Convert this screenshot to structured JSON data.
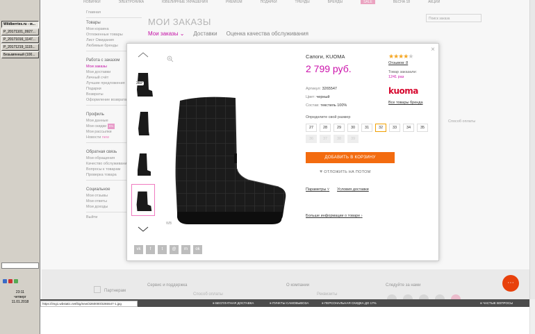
{
  "taskbar": {
    "buttons": [
      "Wildberries.ru - м...",
      "P_20171101_0927...",
      "P_20171016_1147...",
      "P_20171219_1115...",
      "Безымянный (100..."
    ],
    "clock_time": "23:11",
    "clock_day": "четверг",
    "clock_date": "11.01.2018"
  },
  "topnav": {
    "items": [
      "НОВИНКИ",
      "ЭЛЕКТРОНИКА",
      "ЮВЕЛИРНЫЕ УКРАШЕНИЯ",
      "PREMIUM",
      "ПОДАРКИ",
      "ТРЕНДЫ",
      "БРЕНДЫ",
      "SALE",
      "ВЕСНА 18",
      "АКЦИИ"
    ]
  },
  "leftmenu": {
    "home": "Главная",
    "sections": [
      {
        "head": "Товары",
        "items": [
          "Мои корзина",
          "Отложенные товары",
          "Лист Ожидания",
          "Любимые бренды"
        ]
      },
      {
        "head": "Работа с заказом",
        "items": [
          "Мои заказы",
          "Мои доставки",
          "Личный счёт",
          "Лучшие предложения",
          "Подарки",
          "Возвраты",
          "Оформление возврата"
        ]
      },
      {
        "head": "Профиль",
        "items": [
          "Мои данные",
          "Мои скидки",
          "Мои рассылки",
          "Новости"
        ]
      },
      {
        "head": "Обратная связь",
        "items": [
          "Мои обращения",
          "Качество обслуживания",
          "Вопросы к товарам",
          "Проверка товара"
        ]
      },
      {
        "head": "Социальное",
        "items": [
          "Мои отзывы",
          "Мои ответы",
          "Мои доходы"
        ]
      }
    ],
    "logout": "Выйти",
    "discount_badge": "5%",
    "news_badge": "new"
  },
  "page": {
    "title": "МОИ ЗАКАЗЫ",
    "tabs": [
      "Мои заказы",
      "Доставки",
      "Оценка качества обслуживания"
    ],
    "search_placeholder": "Поиск заказа",
    "filter_text": "Способ оплаты"
  },
  "modal": {
    "close": "×",
    "wb_mark": "WB",
    "share": [
      "vk",
      "f",
      "t",
      "@",
      "m",
      "ok"
    ],
    "product_name": "Сапоги, KUOMA",
    "price": "2 799 руб.",
    "rating": 4,
    "rating_max": 5,
    "reviews": "Отзывов: 8",
    "ordered_label": "Товар заказали:",
    "ordered_count": "1241 раз",
    "brand_logo": "kuoma",
    "brand_link": "Все товары бренда",
    "article_label": "Артикул:",
    "article": "3265547",
    "color_label": "Цвет:",
    "color": "черный",
    "material_label": "Состав:",
    "material": "текстиль 100%",
    "size_title": "Определите свой размер",
    "sizes": [
      "27",
      "28",
      "29",
      "30",
      "31",
      "32",
      "33",
      "34",
      "35"
    ],
    "sizes_unavailable": [
      "36",
      "37",
      "38",
      "39"
    ],
    "selected_size": "32",
    "add_to_cart": "ДОБАВИТЬ В КОРЗИНУ",
    "postpone": "ОТЛОЖИТЬ НА ПОТОМ",
    "params_link": "Параметры",
    "delivery_link": "Условия доставки",
    "more_info": "Больше информации о товаре",
    "thumb_360": "360°"
  },
  "footer": {
    "partners": "Партнерам",
    "service": "Сервис и поддержка",
    "service_sub": "Способ оплаты",
    "company": "О компании",
    "company_sub": "Реквизиты",
    "follow": "Следуйте за нами"
  },
  "statusbar": {
    "url": "https://img1.wbstatic.net/big/new/3260000/3265547-1.jpg",
    "items": [
      "БЕСПЛАТНАЯ ДОСТАВКА",
      "ПУНКТЫ САМОВЫВОЗА",
      "ПЕРСОНАЛЬНАЯ СКИДКА ДО 17%",
      "ЧАСТЫЕ ВОПРОСЫ"
    ]
  },
  "colors": {
    "accent_pink": "#cb11ab",
    "cart_orange": "#f36b0f",
    "chat_orange": "#f0440d",
    "brand_red": "#d6082e"
  }
}
